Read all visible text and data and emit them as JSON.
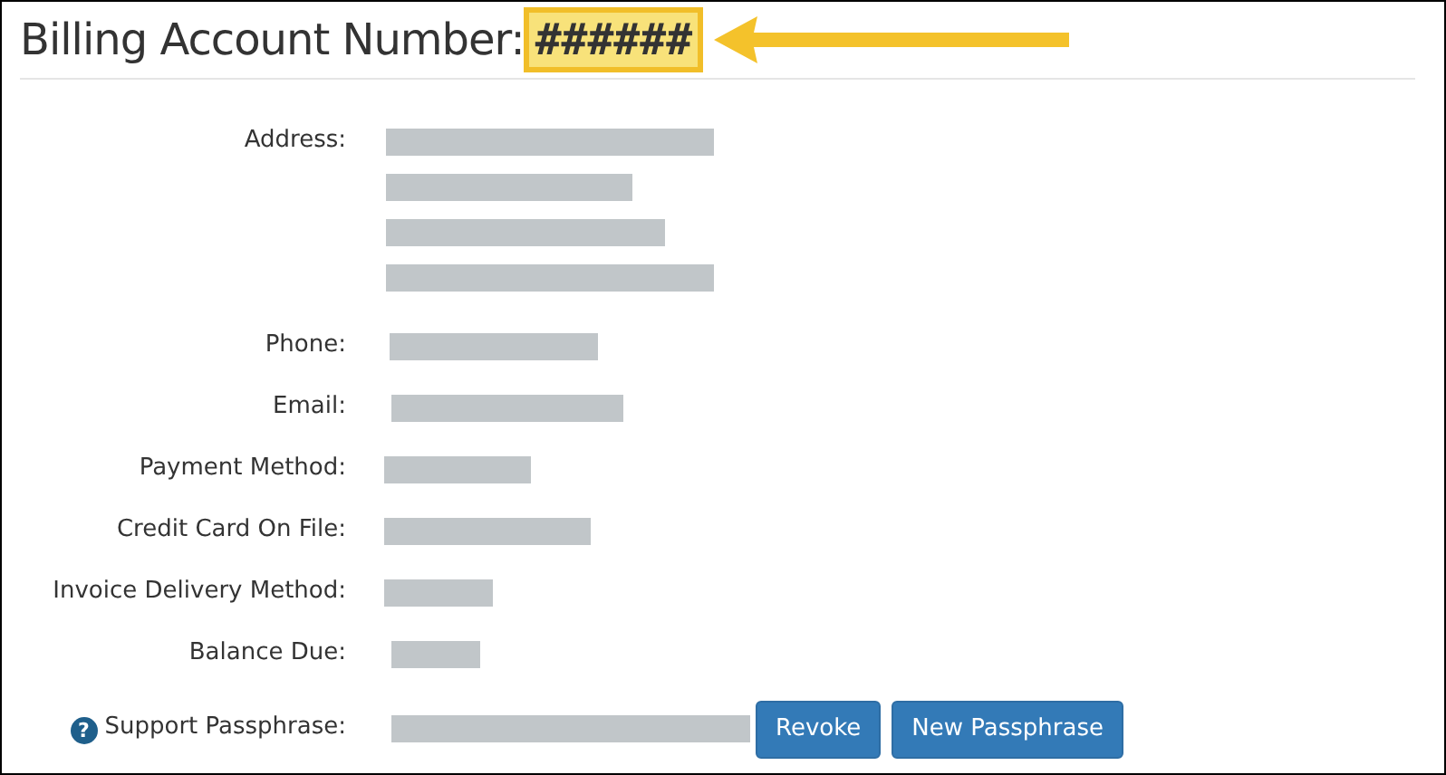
{
  "heading": {
    "title": "Billing Account Number:",
    "number": "######",
    "highlighted": true,
    "callout_arrow": true
  },
  "fields": [
    {
      "label": "Address:",
      "values": [
        {
          "kind": "redacted"
        },
        {
          "kind": "redacted"
        },
        {
          "kind": "redacted"
        },
        {
          "kind": "redacted"
        }
      ]
    },
    {
      "label": "Phone:",
      "values": [
        {
          "kind": "redacted"
        }
      ]
    },
    {
      "label": "Email:",
      "values": [
        {
          "kind": "redacted"
        }
      ]
    },
    {
      "label": "Payment Method:",
      "values": [
        {
          "kind": "redacted"
        }
      ]
    },
    {
      "label": "Credit Card On File:",
      "values": [
        {
          "kind": "redacted"
        }
      ]
    },
    {
      "label": "Invoice Delivery Method:",
      "values": [
        {
          "kind": "redacted"
        }
      ]
    },
    {
      "label": "Balance Due:",
      "values": [
        {
          "kind": "redacted"
        }
      ]
    },
    {
      "label": "Support Passphrase:",
      "help_icon": "?",
      "values": [
        {
          "kind": "redacted"
        }
      ],
      "buttons": [
        "Revoke",
        "New Passphrase"
      ]
    }
  ]
}
